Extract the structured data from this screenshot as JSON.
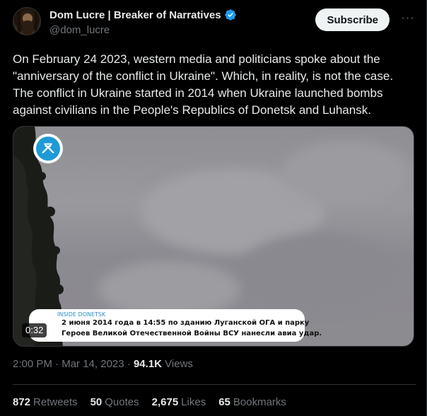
{
  "author": {
    "display_name": "Dom Lucre | Breaker of Narratives",
    "handle": "@dom_lucre",
    "verified": true
  },
  "actions": {
    "subscribe_label": "Subscribe",
    "more_icon": "more-horizontal-icon"
  },
  "tweet": {
    "text": "On February 24 2023, western media and politicians spoke about the \"anniversary of the conflict in Ukraine\". Which, in reality, is not the case. The conflict in Ukraine started in 2014 when Ukraine launched bombs against civilians in the People's Republics of Donetsk and Luhansk."
  },
  "media": {
    "duration": "0:32",
    "caption_tag": "INSIDE DONETSK",
    "caption_line1": "2 июня 2014 года в 14:55 по зданию Луганской ОГА и парку",
    "caption_line2": "Героев Великой Отечественной Войны ВСУ нанесли авиа удар."
  },
  "meta": {
    "time": "2:00 PM",
    "separator": "·",
    "date": "Mar 14, 2023",
    "views_count": "94.1K",
    "views_label": "Views"
  },
  "stats": [
    {
      "count": "872",
      "label": "Retweets"
    },
    {
      "count": "50",
      "label": "Quotes"
    },
    {
      "count": "2,675",
      "label": "Likes"
    },
    {
      "count": "65",
      "label": "Bookmarks"
    }
  ],
  "colors": {
    "background": "#000000",
    "text_primary": "#e7e9ea",
    "text_secondary": "#71767b",
    "verified_blue": "#1d9bf0",
    "border": "#2f3336"
  }
}
